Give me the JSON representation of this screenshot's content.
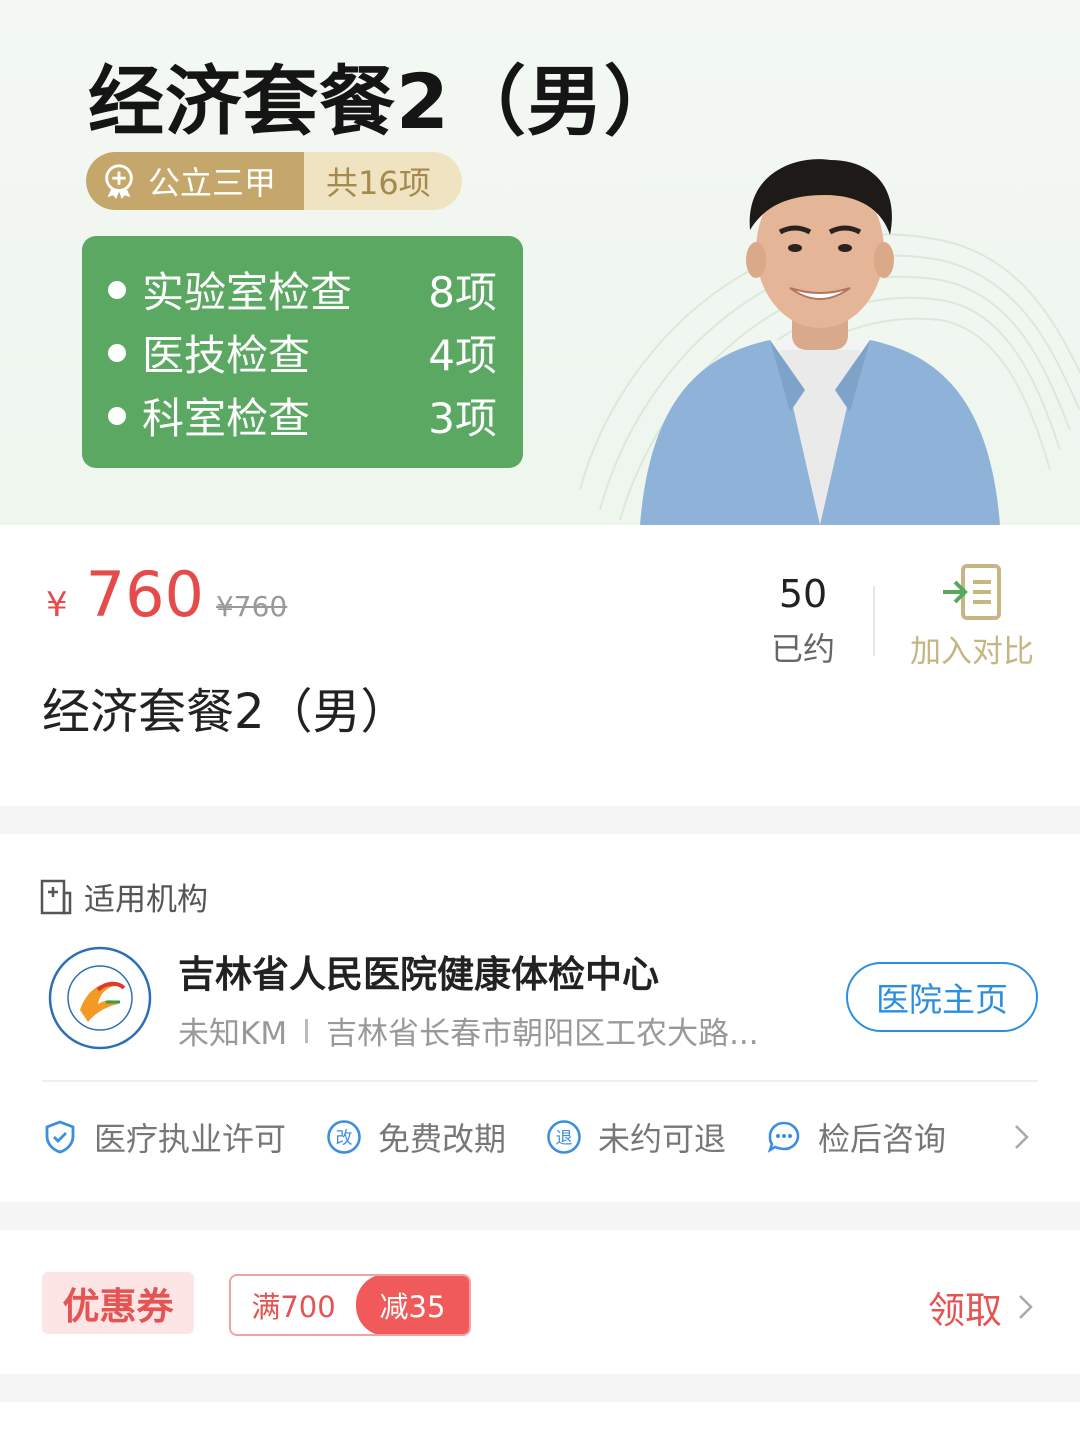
{
  "banner": {
    "title": "经济套餐2（男）",
    "tag_primary": "公立三甲",
    "tag_count": "共16项",
    "checks": [
      {
        "name": "实验室检查",
        "count": "8项"
      },
      {
        "name": "医技检查",
        "count": "4项"
      },
      {
        "name": "科室检查",
        "count": "3项"
      }
    ]
  },
  "price": {
    "currency": "¥",
    "current": "760",
    "original": "¥760"
  },
  "booked": {
    "count": "50",
    "label": "已约"
  },
  "compare": {
    "label": "加入对比"
  },
  "package": {
    "name": "经济套餐2（男）"
  },
  "institution": {
    "section_title": "适用机构",
    "name": "吉林省人民医院健康体检中心",
    "distance": "未知KM",
    "address": "吉林省长春市朝阳区工农大路...",
    "home_button": "医院主页"
  },
  "features": [
    {
      "label": "医疗执业许可",
      "icon": "shield-check-icon"
    },
    {
      "label": "免费改期",
      "icon": "reschedule-icon",
      "glyph": "改"
    },
    {
      "label": "未约可退",
      "icon": "refund-icon",
      "glyph": "退"
    },
    {
      "label": "检后咨询",
      "icon": "chat-icon"
    }
  ],
  "coupon": {
    "tag": "优惠券",
    "condition": "满700",
    "amount": "减35",
    "claim": "领取"
  },
  "colors": {
    "accent_red": "#e55353",
    "brand_green": "#5aa861",
    "link_blue": "#2b8ee0",
    "gold": "#c5a76b"
  }
}
